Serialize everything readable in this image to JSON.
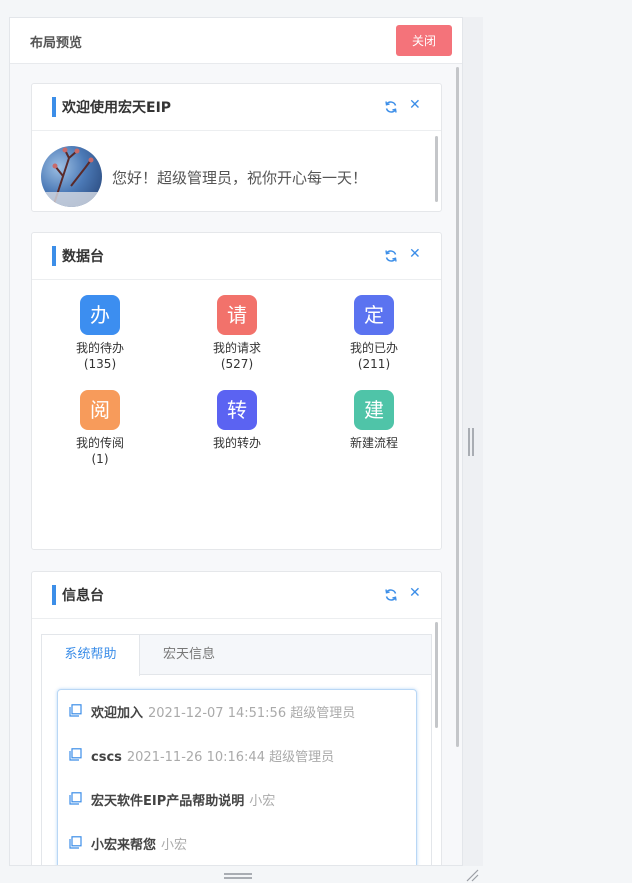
{
  "panel": {
    "title": "布局预览",
    "close_label": "关闭"
  },
  "welcome_card": {
    "title": "欢迎使用宏天EIP",
    "greeting": "您好！超级管理员，祝你开心每一天！"
  },
  "data_card": {
    "title": "数据台",
    "items": [
      {
        "icon_char": "办",
        "icon_color": "#3c8ef0",
        "label": "我的待办",
        "count": "(135)"
      },
      {
        "icon_char": "请",
        "icon_color": "#f2726b",
        "label": "我的请求",
        "count": "(527)"
      },
      {
        "icon_char": "定",
        "icon_color": "#5b73f0",
        "label": "我的已办",
        "count": "(211)"
      },
      {
        "icon_char": "阅",
        "icon_color": "#f79b5b",
        "label": "我的传阅",
        "count": "(1)"
      },
      {
        "icon_char": "转",
        "icon_color": "#5b63f2",
        "label": "我的转办",
        "count": ""
      },
      {
        "icon_char": "建",
        "icon_color": "#4fc4a8",
        "label": "新建流程",
        "count": ""
      }
    ]
  },
  "info_card": {
    "title": "信息台",
    "tabs": [
      "系统帮助",
      "宏天信息"
    ],
    "active_tab": 0,
    "news": [
      {
        "title": "欢迎加入",
        "meta": "2021-12-07 14:51:56 超级管理员"
      },
      {
        "title": "cscs",
        "meta": "2021-11-26 10:16:44 超级管理员"
      },
      {
        "title": "宏天软件EIP产品帮助说明",
        "meta": "小宏"
      },
      {
        "title": "小宏来帮您",
        "meta": "小宏"
      }
    ]
  },
  "icons": {
    "refresh": "refresh-icon",
    "close": "close-icon",
    "news": "document-icon"
  },
  "colors": {
    "accent": "#3c8ee8",
    "close_button": "#f4737a"
  }
}
